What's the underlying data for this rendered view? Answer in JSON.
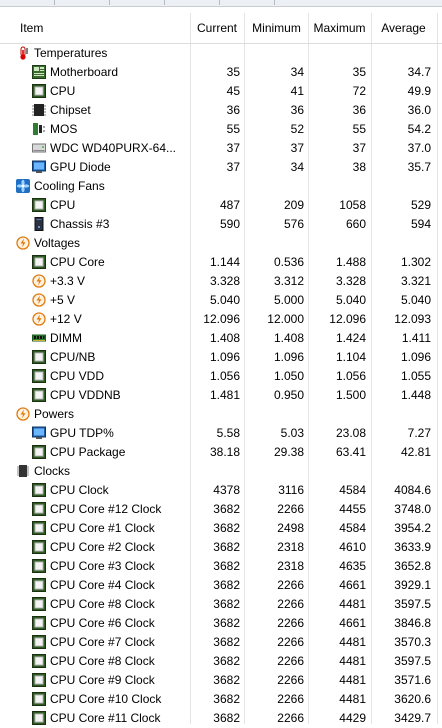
{
  "columns": {
    "item": "Item",
    "current": "Current",
    "minimum": "Minimum",
    "maximum": "Maximum",
    "average": "Average"
  },
  "groups": [
    {
      "label": "Temperatures",
      "icon": "thermometer-icon",
      "rows": [
        {
          "label": "Motherboard",
          "icon": "motherboard-icon",
          "cur": "35",
          "min": "34",
          "max": "35",
          "avg": "34.7"
        },
        {
          "label": "CPU",
          "icon": "cpu-icon",
          "cur": "45",
          "min": "41",
          "max": "72",
          "avg": "49.9"
        },
        {
          "label": "Chipset",
          "icon": "chipset-icon",
          "cur": "36",
          "min": "36",
          "max": "36",
          "avg": "36.0"
        },
        {
          "label": "MOS",
          "icon": "mos-icon",
          "cur": "55",
          "min": "52",
          "max": "55",
          "avg": "54.2"
        },
        {
          "label": "WDC WD40PURX-64...",
          "icon": "hard-drive-icon",
          "cur": "37",
          "min": "37",
          "max": "37",
          "avg": "37.0"
        },
        {
          "label": "GPU Diode",
          "icon": "gpu-icon",
          "cur": "37",
          "min": "34",
          "max": "38",
          "avg": "35.7"
        }
      ]
    },
    {
      "label": "Cooling Fans",
      "icon": "fan-icon",
      "rows": [
        {
          "label": "CPU",
          "icon": "cpu-icon",
          "cur": "487",
          "min": "209",
          "max": "1058",
          "avg": "529"
        },
        {
          "label": "Chassis #3",
          "icon": "chassis-icon",
          "cur": "590",
          "min": "576",
          "max": "660",
          "avg": "594"
        }
      ]
    },
    {
      "label": "Voltages",
      "icon": "voltage-icon",
      "rows": [
        {
          "label": "CPU Core",
          "icon": "cpu-icon",
          "cur": "1.144",
          "min": "0.536",
          "max": "1.488",
          "avg": "1.302"
        },
        {
          "label": "+3.3 V",
          "icon": "voltage-icon",
          "cur": "3.328",
          "min": "3.312",
          "max": "3.328",
          "avg": "3.321"
        },
        {
          "label": "+5 V",
          "icon": "voltage-icon",
          "cur": "5.040",
          "min": "5.000",
          "max": "5.040",
          "avg": "5.040"
        },
        {
          "label": "+12 V",
          "icon": "voltage-icon",
          "cur": "12.096",
          "min": "12.000",
          "max": "12.096",
          "avg": "12.093"
        },
        {
          "label": "DIMM",
          "icon": "dimm-icon",
          "cur": "1.408",
          "min": "1.408",
          "max": "1.424",
          "avg": "1.411"
        },
        {
          "label": "CPU/NB",
          "icon": "cpu-icon",
          "cur": "1.096",
          "min": "1.096",
          "max": "1.104",
          "avg": "1.096"
        },
        {
          "label": "CPU VDD",
          "icon": "cpu-icon",
          "cur": "1.056",
          "min": "1.050",
          "max": "1.056",
          "avg": "1.055"
        },
        {
          "label": "CPU VDDNB",
          "icon": "cpu-icon",
          "cur": "1.481",
          "min": "0.950",
          "max": "1.500",
          "avg": "1.448"
        }
      ]
    },
    {
      "label": "Powers",
      "icon": "power-icon",
      "rows": [
        {
          "label": "GPU TDP%",
          "icon": "gpu-icon",
          "cur": "5.58",
          "min": "5.03",
          "max": "23.08",
          "avg": "7.27"
        },
        {
          "label": "CPU Package",
          "icon": "cpu-icon",
          "cur": "38.18",
          "min": "29.38",
          "max": "63.41",
          "avg": "42.81"
        }
      ]
    },
    {
      "label": "Clocks",
      "icon": "clock-chip-icon",
      "rows": [
        {
          "label": "CPU Clock",
          "icon": "cpu-icon",
          "cur": "4378",
          "min": "3116",
          "max": "4584",
          "avg": "4084.6"
        },
        {
          "label": "CPU Core #12 Clock",
          "icon": "cpu-icon",
          "cur": "3682",
          "min": "2266",
          "max": "4455",
          "avg": "3748.0"
        },
        {
          "label": "CPU Core #1 Clock",
          "icon": "cpu-icon",
          "cur": "3682",
          "min": "2498",
          "max": "4584",
          "avg": "3954.2"
        },
        {
          "label": "CPU Core #2 Clock",
          "icon": "cpu-icon",
          "cur": "3682",
          "min": "2318",
          "max": "4610",
          "avg": "3633.9"
        },
        {
          "label": "CPU Core #3 Clock",
          "icon": "cpu-icon",
          "cur": "3682",
          "min": "2318",
          "max": "4635",
          "avg": "3652.8"
        },
        {
          "label": "CPU Core #4 Clock",
          "icon": "cpu-icon",
          "cur": "3682",
          "min": "2266",
          "max": "4661",
          "avg": "3929.1"
        },
        {
          "label": "CPU Core #8 Clock",
          "icon": "cpu-icon",
          "cur": "3682",
          "min": "2266",
          "max": "4481",
          "avg": "3597.5"
        },
        {
          "label": "CPU Core #6 Clock",
          "icon": "cpu-icon",
          "cur": "3682",
          "min": "2266",
          "max": "4661",
          "avg": "3846.8"
        },
        {
          "label": "CPU Core #7 Clock",
          "icon": "cpu-icon",
          "cur": "3682",
          "min": "2266",
          "max": "4481",
          "avg": "3570.3"
        },
        {
          "label": "CPU Core #8 Clock",
          "icon": "cpu-icon",
          "cur": "3682",
          "min": "2266",
          "max": "4481",
          "avg": "3597.5"
        },
        {
          "label": "CPU Core #9 Clock",
          "icon": "cpu-icon",
          "cur": "3682",
          "min": "2266",
          "max": "4481",
          "avg": "3571.6"
        },
        {
          "label": "CPU Core #10 Clock",
          "icon": "cpu-icon",
          "cur": "3682",
          "min": "2266",
          "max": "4481",
          "avg": "3620.6"
        },
        {
          "label": "CPU Core #11 Clock",
          "icon": "cpu-icon",
          "cur": "3682",
          "min": "2266",
          "max": "4429",
          "avg": "3429.7"
        }
      ]
    }
  ]
}
